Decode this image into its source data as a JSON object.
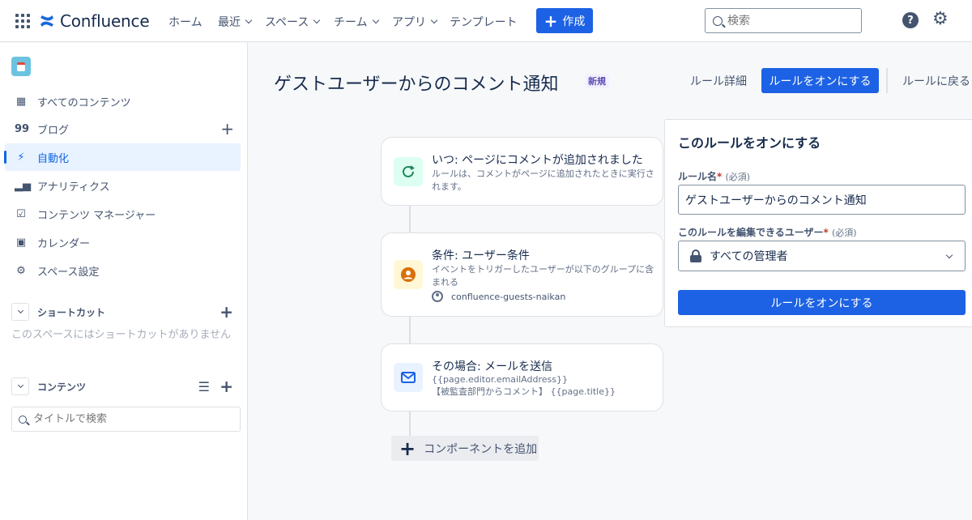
{
  "topnav": {
    "app_name": "Confluence",
    "items": [
      {
        "label": "ホーム"
      },
      {
        "label": "最近"
      },
      {
        "label": "スペース"
      },
      {
        "label": "チーム"
      },
      {
        "label": "アプリ"
      },
      {
        "label": "テンプレート"
      }
    ],
    "create_label": "作成",
    "search_placeholder": "検索",
    "help_glyph": "?",
    "settings_glyph": "⚙"
  },
  "sidebar": {
    "items": [
      {
        "label": "すべてのコンテンツ",
        "icon": "grid-icon"
      },
      {
        "label": "ブログ",
        "icon": "quote-icon"
      },
      {
        "label": "自動化",
        "icon": "lightning-icon",
        "active": true
      },
      {
        "label": "アナリティクス",
        "icon": "bar-chart-icon"
      },
      {
        "label": "コンテンツ マネージャー",
        "icon": "checklist-icon"
      },
      {
        "label": "カレンダー",
        "icon": "calendar-icon"
      },
      {
        "label": "スペース設定",
        "icon": "gear-icon"
      }
    ],
    "shortcuts": {
      "heading": "ショートカット",
      "empty_text": "このスペースにはショートカットがありません"
    },
    "contents": {
      "heading": "コンテンツ",
      "search_placeholder": "タイトルで検索"
    }
  },
  "header": {
    "title": "ゲストユーザーからのコメント通知",
    "badge": "新規",
    "rule_details": "ルール詳細",
    "enable_rule": "ルールをオンにする",
    "back_to_rules": "ルールに戻る"
  },
  "flow": {
    "trigger": {
      "title": "いつ: ページにコメントが追加されました",
      "desc": "ルールは、コメントがページに追加されたときに実行されます。"
    },
    "condition": {
      "title": "条件: ユーザー条件",
      "desc": "イベントをトリガーしたユーザーが以下のグループに含まれる",
      "group": "confluence-guests-naikan"
    },
    "action": {
      "title": "その場合: メールを送信",
      "line1": "{{page.editor.emailAddress}}",
      "line2": "【被監査部門からコメント】 {{page.title}}"
    },
    "add_component": "コンポーネントを追加"
  },
  "panel": {
    "title": "このルールをオンにする",
    "name_label": "ルール名",
    "required_mark": "*",
    "required_text": "(必須)",
    "name_value": "ゲストユーザーからのコメント通知",
    "editors_label": "このルールを編集できるユーザー",
    "editors_value": "すべての管理者",
    "submit": "ルールをオンにする"
  },
  "colors": {
    "primary": "#1d62e4",
    "active_nav_bg": "#e9f2ff",
    "trigger_icon_bg": "#dcfff1",
    "condition_icon_bg": "#fff7d6",
    "action_icon_bg": "#e9f2ff"
  }
}
